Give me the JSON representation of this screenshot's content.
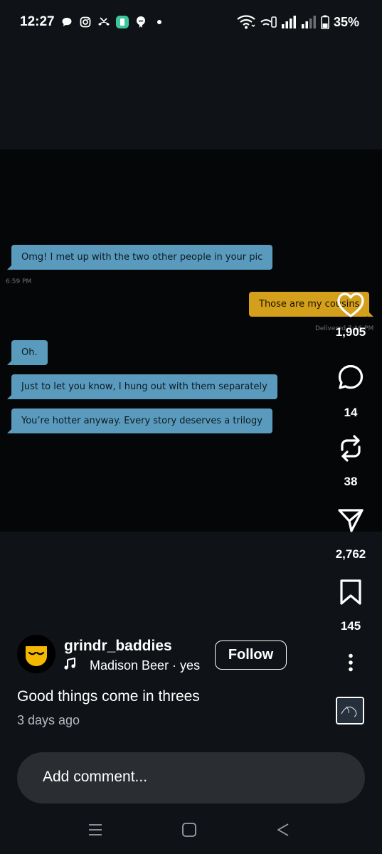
{
  "status_bar": {
    "time": "12:27",
    "battery": "35%",
    "notification_icons": [
      "chat-bubble-icon",
      "instagram-icon",
      "missed-call-icon",
      "app-icon",
      "grindr-icon",
      "dot-icon"
    ],
    "system_icons": [
      "wifi-icon",
      "wifi-calling-icon",
      "signal-icon",
      "signal-weak-icon",
      "battery-icon"
    ]
  },
  "video": {
    "messages": [
      {
        "side": "in",
        "text": "Omg! I met up with the two other people in your pic"
      },
      {
        "side": "time",
        "text": "6:59 PM"
      },
      {
        "side": "out",
        "text": "Those are my cousins"
      },
      {
        "side": "status",
        "text": "Delivered 7:16 PM"
      },
      {
        "side": "in",
        "text": "Oh."
      },
      {
        "side": "in",
        "text": "Just to let you know, I hung out with them separately"
      },
      {
        "side": "in",
        "text": "You’re hotter anyway. Every story deserves a trilogy"
      }
    ]
  },
  "actions": {
    "likes": "1,905",
    "comments": "14",
    "reposts": "38",
    "shares": "2,762",
    "saves": "145"
  },
  "post": {
    "username": "grindr_baddies",
    "music": "Madison Beer · yes",
    "follow_label": "Follow",
    "caption": "Good things come in threes",
    "time_ago": "3 days ago"
  },
  "comment": {
    "placeholder": "Add comment..."
  },
  "colors": {
    "background": "#0f1216",
    "incoming_bubble": "#5a9bbd",
    "outgoing_bubble": "#d4a01b",
    "avatar_yellow": "#f5b800",
    "comment_bar": "#2a2d31"
  }
}
